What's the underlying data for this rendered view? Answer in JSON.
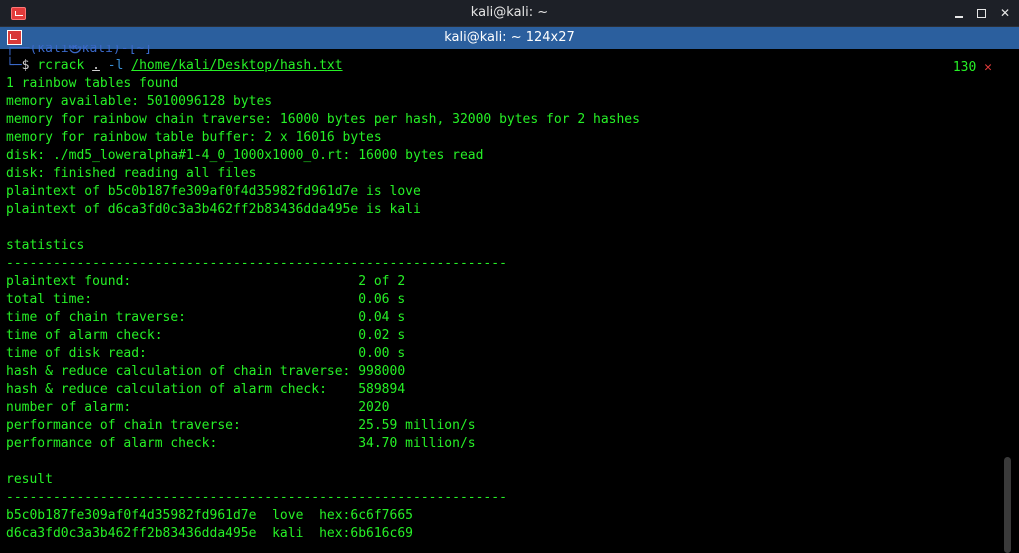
{
  "window": {
    "title": "kali@kali: ~",
    "controls": {
      "minimize": "",
      "maximize": "",
      "close": "✕"
    }
  },
  "tab": {
    "title": "kali@kali: ~ 124x27"
  },
  "prompt": {
    "top_fragment": "┌──(kali㉿kali)-[~]",
    "corner": "└─",
    "dollar": "$ ",
    "command": "rcrack",
    "arg_dot": ".",
    "flag": "-l",
    "path": "/home/kali/Desktop/hash.txt"
  },
  "status": {
    "exit_code": "130",
    "error_icon": "✕"
  },
  "output": {
    "lines": [
      "1 rainbow tables found",
      "memory available: 5010096128 bytes",
      "memory for rainbow chain traverse: 16000 bytes per hash, 32000 bytes for 2 hashes",
      "memory for rainbow table buffer: 2 x 16016 bytes",
      "disk: ./md5_loweralpha#1-4_0_1000x1000_0.rt: 16000 bytes read",
      "disk: finished reading all files",
      "plaintext of b5c0b187fe309af0f4d35982fd961d7e is love",
      "plaintext of d6ca3fd0c3a3b462ff2b83436dda495e is kali",
      "",
      "statistics",
      "----------------------------------------------------------------",
      "plaintext found:                             2 of 2",
      "total time:                                  0.06 s",
      "time of chain traverse:                      0.04 s",
      "time of alarm check:                         0.02 s",
      "time of disk read:                           0.00 s",
      "hash & reduce calculation of chain traverse: 998000",
      "hash & reduce calculation of alarm check:    589894",
      "number of alarm:                             2020",
      "performance of chain traverse:               25.59 million/s",
      "performance of alarm check:                  34.70 million/s",
      "",
      "result",
      "----------------------------------------------------------------",
      "b5c0b187fe309af0f4d35982fd961d7e  love  hex:6c6f7665",
      "d6ca3fd0c3a3b462ff2b83436dda495e  kali  hex:6b616c69"
    ]
  },
  "colors": {
    "terminal_text": "#26f026",
    "tab_bar": "#2b5f9e",
    "titlebar": "#1d2027",
    "error": "#e23b3b"
  }
}
